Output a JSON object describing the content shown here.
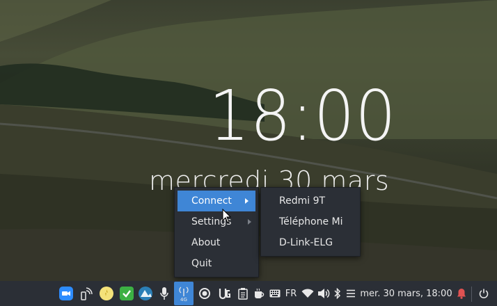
{
  "clock": {
    "time": "18:00",
    "date": "mercredi 30 mars"
  },
  "menu": {
    "items": [
      {
        "label": "Connect",
        "has_submenu": true,
        "active": true
      },
      {
        "label": "Settings",
        "has_submenu": true,
        "active": false
      },
      {
        "label": "About",
        "has_submenu": false,
        "active": false
      },
      {
        "label": "Quit",
        "has_submenu": false,
        "active": false
      }
    ]
  },
  "submenu": {
    "items": [
      {
        "label": "Redmi 9T"
      },
      {
        "label": "Téléphone Mi"
      },
      {
        "label": "D-Link-ELG"
      }
    ]
  },
  "taskbar": {
    "icons": [
      "zoom-icon",
      "kdeconnect-icon",
      "yellow-app-icon",
      "green-check-icon",
      "teal-app-icon",
      "microphone-icon",
      "modem-4g-icon",
      "record-icon",
      "ug-app-icon",
      "clipboard-icon",
      "coffee-icon",
      "keyboard-icon",
      "wifi-icon",
      "volume-icon",
      "bluetooth-icon",
      "menu-icon",
      "bell-icon",
      "power-icon"
    ],
    "modem_label": "4G",
    "keyboard_layout": "FR",
    "datetime": "mer. 30 mars, 18:00",
    "accent": "#3f86d6",
    "background": "#2b2f36"
  }
}
